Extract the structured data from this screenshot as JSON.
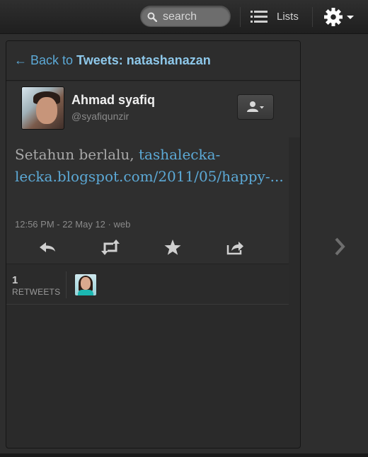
{
  "topbar": {
    "search_placeholder": "search",
    "lists_label": "Lists"
  },
  "panel": {
    "back_prefix": "← Back to ",
    "back_target": "Tweets: natashanazan"
  },
  "user": {
    "name": "Ahmad syafiq",
    "handle": "@syafiqunzir"
  },
  "tweet": {
    "text_plain": "Setahun berlalu, ",
    "text_link": "tashalecka-lecka.blogspot.com/2011/05/happy-...",
    "meta": "12:56 PM - 22 May 12 · web"
  },
  "retweets": {
    "count": "1",
    "label": "RETWEETS"
  },
  "colors": {
    "link": "#5ca9d6",
    "background": "#2e2e2e"
  },
  "icons": [
    "search-icon",
    "list-icon",
    "gear-icon",
    "chevron-down-icon",
    "user-icon",
    "reply-icon",
    "retweet-icon",
    "favorite-icon",
    "share-icon",
    "chevron-right-icon"
  ]
}
